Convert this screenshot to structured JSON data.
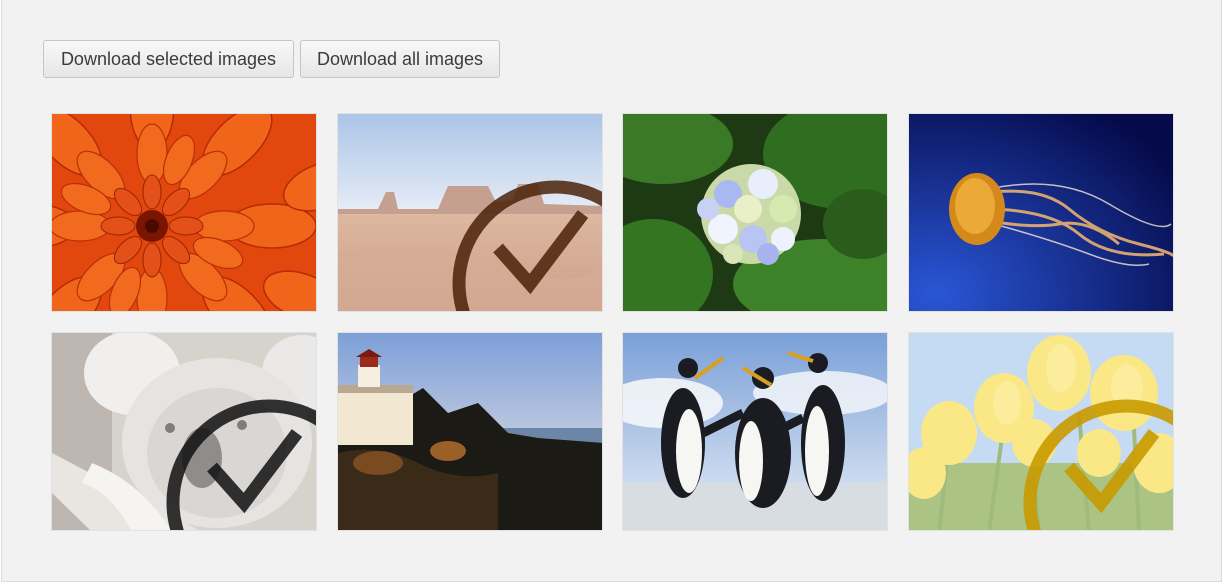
{
  "toolbar": {
    "download_selected_label": "Download selected images",
    "download_all_label": "Download all images"
  },
  "images": [
    {
      "subject": "orange-flower",
      "selected": false
    },
    {
      "subject": "desert",
      "selected": true
    },
    {
      "subject": "hydrangea",
      "selected": false
    },
    {
      "subject": "jellyfish",
      "selected": false
    },
    {
      "subject": "koala",
      "selected": true
    },
    {
      "subject": "lighthouse",
      "selected": false
    },
    {
      "subject": "penguins",
      "selected": false
    },
    {
      "subject": "tulips",
      "selected": true
    }
  ],
  "colors": {
    "background": "#f2f2f2",
    "button_text": "#3b3b3b",
    "button_border": "#c4c4c4"
  }
}
